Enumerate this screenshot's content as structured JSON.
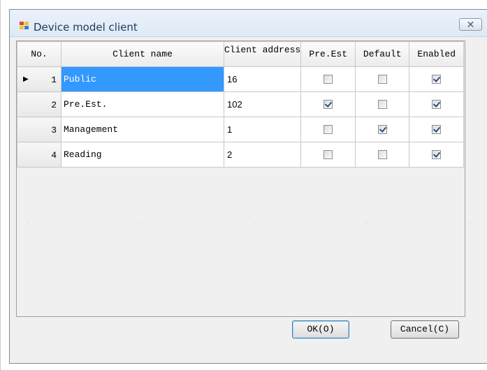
{
  "window": {
    "title": "Device model client",
    "close_label": "✕"
  },
  "grid": {
    "columns": [
      "No.",
      "Client name",
      "Client address",
      "Pre.Est",
      "Default",
      "Enabled"
    ],
    "rows": [
      {
        "no": "1",
        "name": "Public",
        "address": "16",
        "pre_est": false,
        "default": false,
        "enabled": true,
        "current": true
      },
      {
        "no": "2",
        "name": "Pre.Est.",
        "address": "102",
        "pre_est": true,
        "default": false,
        "enabled": true,
        "current": false
      },
      {
        "no": "3",
        "name": "Management",
        "address": "1",
        "pre_est": false,
        "default": true,
        "enabled": true,
        "current": false
      },
      {
        "no": "4",
        "name": "Reading",
        "address": "2",
        "pre_est": false,
        "default": false,
        "enabled": true,
        "current": false
      }
    ]
  },
  "buttons": {
    "ok": "OK(O)",
    "cancel": "Cancel(C)"
  },
  "colors": {
    "selection": "#3399ff",
    "title_text": "#1e3a5f"
  },
  "icons": {
    "app": "window-app-icon",
    "close": "close-icon",
    "row_pointer": "row-pointer-icon"
  }
}
